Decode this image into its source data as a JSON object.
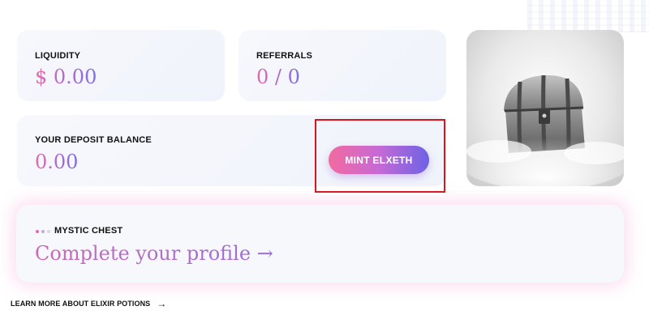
{
  "stats": {
    "liquidity": {
      "label": "LIQUIDITY",
      "value": "$ 0.00"
    },
    "referrals": {
      "label": "REFERRALS",
      "value": "0 / 0"
    },
    "deposit": {
      "label": "YOUR DEPOSIT BALANCE",
      "value": "0.00"
    }
  },
  "mint_button": {
    "label": "MINT ELXETH"
  },
  "chest_image": {
    "icon": "treasure-chest-image"
  },
  "mystic_chest": {
    "label": "MYSTIC CHEST",
    "cta": "Complete your profile →"
  },
  "learn_more": {
    "label": "LEARN MORE ABOUT ELIXIR POTIONS",
    "arrow": "→"
  },
  "colors": {
    "accent_pink": "#f36a9f",
    "accent_purple": "#6d62e5",
    "highlight_red": "#d9141b"
  }
}
